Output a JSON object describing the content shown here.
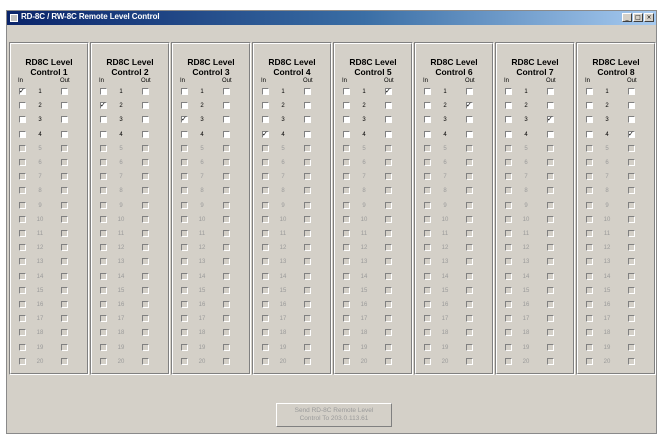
{
  "window": {
    "title": "RD-8C / RW-8C Remote Level Control",
    "min_btn": "_",
    "max_btn": "□",
    "close_btn": "×"
  },
  "io": {
    "in_label": "In",
    "out_label": "Out"
  },
  "panels": [
    {
      "title_line1": "RD8C Level",
      "title_line2": "Control 1",
      "in_checked": 1,
      "out_checked": null
    },
    {
      "title_line1": "RD8C Level",
      "title_line2": "Control 2",
      "in_checked": 2,
      "out_checked": null
    },
    {
      "title_line1": "RD8C Level",
      "title_line2": "Control 3",
      "in_checked": 3,
      "out_checked": null
    },
    {
      "title_line1": "RD8C Level",
      "title_line2": "Control 4",
      "in_checked": 4,
      "out_checked": null
    },
    {
      "title_line1": "RD8C Level",
      "title_line2": "Control 5",
      "in_checked": null,
      "out_checked": 1
    },
    {
      "title_line1": "RD8C Level",
      "title_line2": "Control 6",
      "in_checked": null,
      "out_checked": 2
    },
    {
      "title_line1": "RD8C Level",
      "title_line2": "Control 7",
      "in_checked": null,
      "out_checked": 3
    },
    {
      "title_line1": "RD8C Level",
      "title_line2": "Control 8",
      "in_checked": null,
      "out_checked": 4
    }
  ],
  "rows": [
    "1",
    "2",
    "3",
    "4",
    "5",
    "6",
    "7",
    "8",
    "9",
    "10",
    "11",
    "12",
    "13",
    "14",
    "15",
    "16",
    "17",
    "18",
    "19",
    "20"
  ],
  "enabled_rows": 4,
  "send_button": {
    "line1": "Send RD-8C Remote Level",
    "line2": "Control To 203.0.113.61"
  }
}
